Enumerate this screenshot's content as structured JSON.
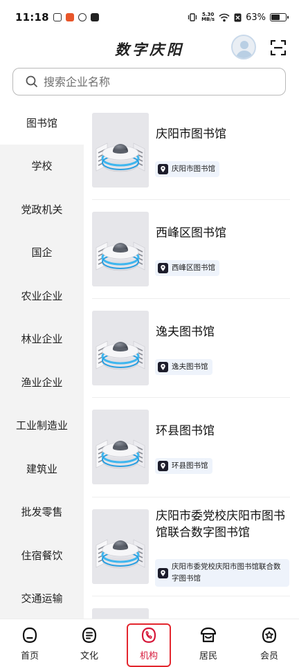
{
  "status_bar": {
    "time": "11:18",
    "net_speed_value": "5.30",
    "net_speed_unit": "MB/s",
    "battery_percent": "63%",
    "battery_level": 0.63
  },
  "header": {
    "title": "数字庆阳"
  },
  "search": {
    "placeholder": "搜索企业名称"
  },
  "sidebar": {
    "items": [
      {
        "label": "图书馆",
        "active": true
      },
      {
        "label": "学校"
      },
      {
        "label": "党政机关"
      },
      {
        "label": "国企"
      },
      {
        "label": "农业企业"
      },
      {
        "label": "林业企业"
      },
      {
        "label": "渔业企业"
      },
      {
        "label": "工业制造业"
      },
      {
        "label": "建筑业"
      },
      {
        "label": "批发零售"
      },
      {
        "label": "住宿餐饮"
      },
      {
        "label": "交通运输"
      }
    ]
  },
  "cards": [
    {
      "title": "庆阳市图书馆",
      "tag": "庆阳市图书馆"
    },
    {
      "title": "西峰区图书馆",
      "tag": "西峰区图书馆"
    },
    {
      "title": "逸夫图书馆",
      "tag": "逸夫图书馆"
    },
    {
      "title": "环县图书馆",
      "tag": "环县图书馆"
    },
    {
      "title": "庆阳市委党校庆阳市图书馆联合数字图书馆",
      "tag": "庆阳市委党校庆阳市图书馆联合数字图书馆"
    }
  ],
  "tabbar": {
    "tabs": [
      {
        "label": "首页",
        "icon": "home-icon"
      },
      {
        "label": "文化",
        "icon": "culture-icon"
      },
      {
        "label": "机构",
        "icon": "institution-icon",
        "active": true
      },
      {
        "label": "居民",
        "icon": "resident-icon"
      },
      {
        "label": "会员",
        "icon": "member-icon"
      }
    ],
    "highlight_color": "#e3262e"
  }
}
